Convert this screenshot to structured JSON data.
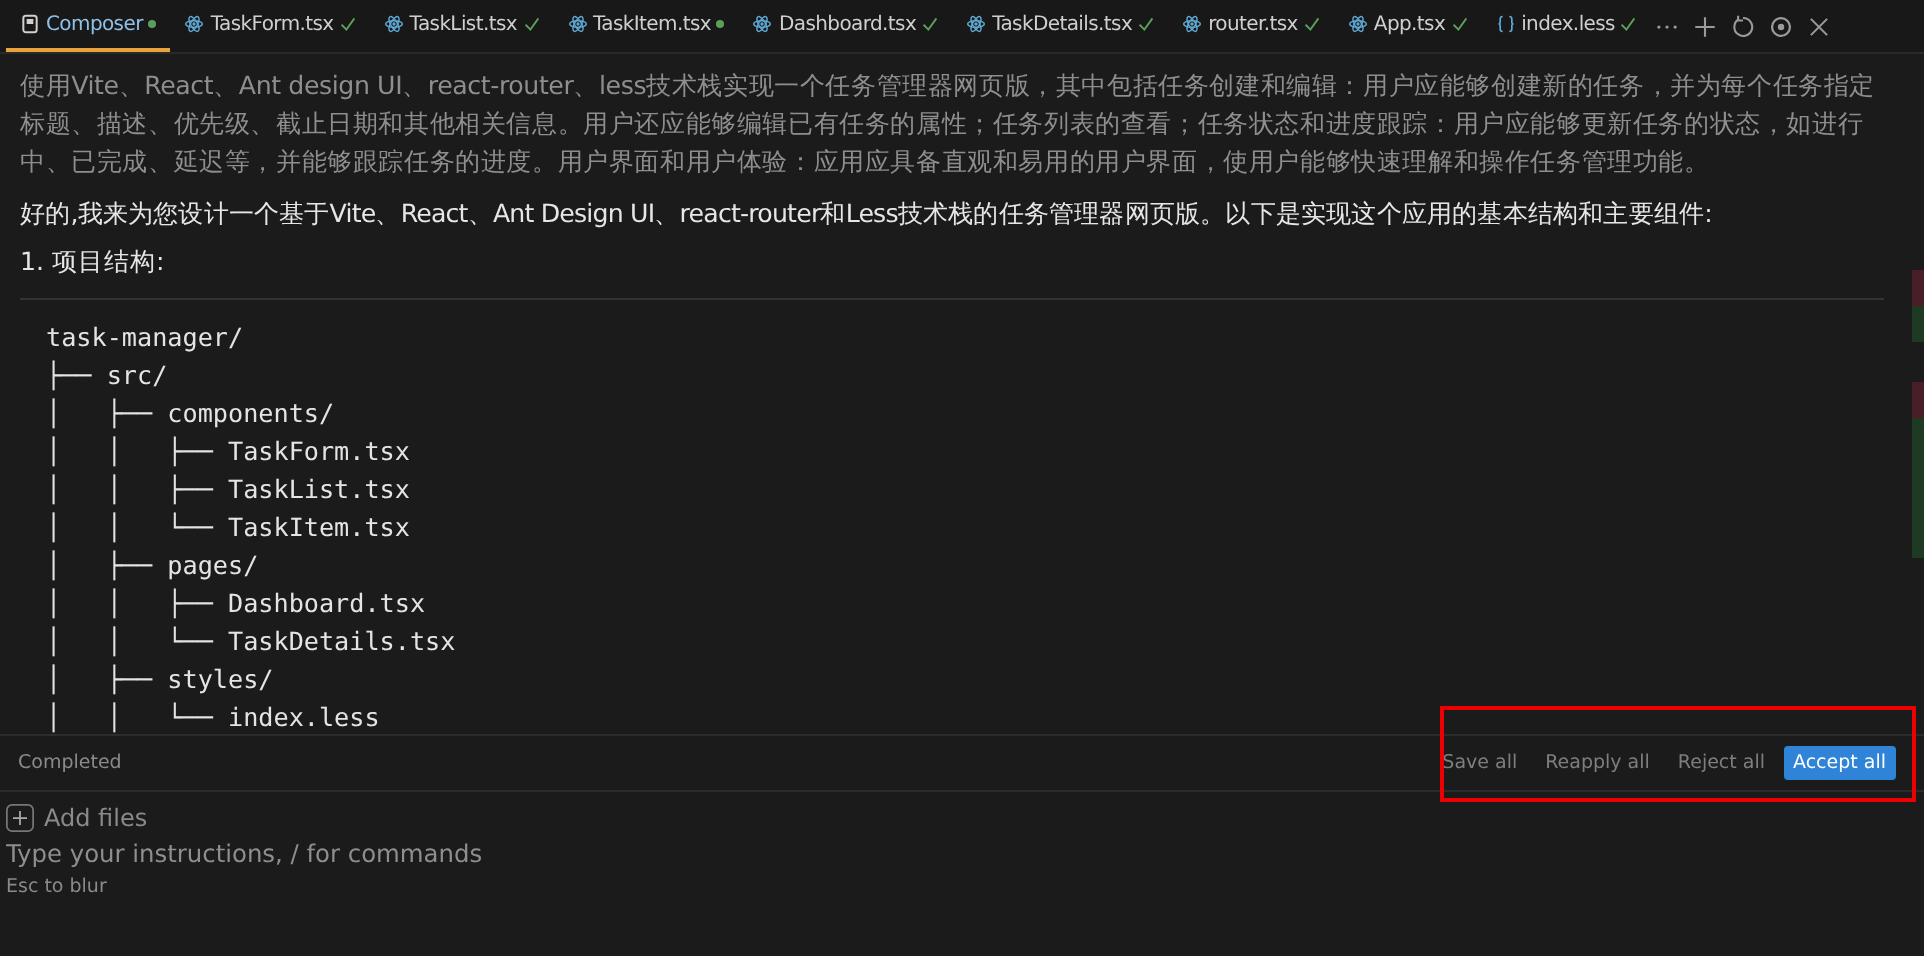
{
  "tabs": [
    {
      "label": "Composer",
      "kind": "composer",
      "modified": true,
      "selected": true
    },
    {
      "label": "TaskForm.tsx",
      "kind": "react",
      "modified": false,
      "selected": false
    },
    {
      "label": "TaskList.tsx",
      "kind": "react",
      "modified": false,
      "selected": false
    },
    {
      "label": "TaskItem.tsx",
      "kind": "react",
      "modified": true,
      "selected": false
    },
    {
      "label": "Dashboard.tsx",
      "kind": "react",
      "modified": false,
      "selected": false
    },
    {
      "label": "TaskDetails.tsx",
      "kind": "react",
      "modified": false,
      "selected": false
    },
    {
      "label": "router.tsx",
      "kind": "react",
      "modified": false,
      "selected": false
    },
    {
      "label": "App.tsx",
      "kind": "react",
      "modified": false,
      "selected": false
    },
    {
      "label": "index.less",
      "kind": "braces",
      "modified": false,
      "selected": false
    }
  ],
  "toolbar": [
    {
      "kind": "more"
    },
    {
      "kind": "plus"
    },
    {
      "kind": "history"
    },
    {
      "kind": "settings"
    },
    {
      "kind": "close"
    }
  ],
  "prompt": "使用Vite、React、Ant design UI、react-router、less技术栈实现一个任务管理器网页版，其中包括任务创建和编辑：用户应能够创建新的任务，并为每个任务指定标题、描述、优先级、截止日期和其他相关信息。用户还应能够编辑已有任务的属性；任务列表的查看；任务状态和进度跟踪：用户应能够更新任务的状态，如进行中、已完成、延迟等，并能够跟踪任务的进度。用户界面和用户体验：应用应具备直观和易用的用户界面，使用户能够快速理解和操作任务管理功能。",
  "answer": "好的,我来为您设计一个基于Vite、React、Ant Design UI、react-router和Less技术栈的任务管理器网页版。以下是实现这个应用的基本结构和主要组件:",
  "heading": "1. 项目结构:",
  "code_lines": [
    "task-manager/",
    "├── src/",
    "│   ├── components/",
    "│   │   ├── TaskForm.tsx",
    "│   │   ├── TaskList.tsx",
    "│   │   └── TaskItem.tsx",
    "│   ├── pages/",
    "│   │   ├── Dashboard.tsx",
    "│   │   └── TaskDetails.tsx",
    "│   ├── styles/",
    "│   │   └── index.less"
  ],
  "status": "Completed",
  "actions": [
    {
      "label": "Save all",
      "primary": false
    },
    {
      "label": "Reapply all",
      "primary": false
    },
    {
      "label": "Reject all",
      "primary": false
    },
    {
      "label": "Accept all",
      "primary": true
    }
  ],
  "add_files": "Add files",
  "input": {
    "placeholder": "Type your instructions, / for commands"
  },
  "hint": "Esc to blur",
  "diff_marks": [
    {
      "color": "#4a1e28"
    },
    {
      "color": "#1f3a22"
    },
    {
      "color": "#4a1e28"
    },
    {
      "color": "#1f3a22"
    }
  ]
}
